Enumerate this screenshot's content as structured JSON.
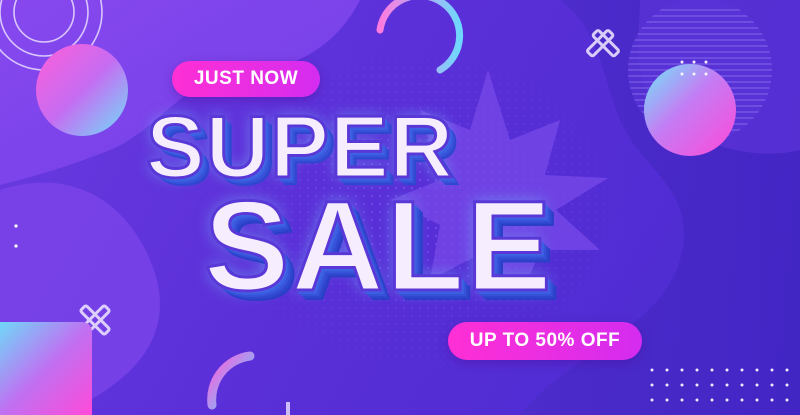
{
  "banner": {
    "badge_top": "JUST NOW",
    "headline_line1": "SUPER",
    "headline_line2": "SALE",
    "badge_bottom": "UP TO 50% OFF"
  },
  "colors": {
    "background": "#5a2fd8",
    "accent_pink": "#ff2fd4",
    "accent_magenta": "#d42cf0",
    "headline_fill": "#f6eefe",
    "headline_extrusion": "#3b5fe0"
  },
  "icons": [
    "concentric-circles-icon",
    "gradient-sphere-icon",
    "cross-icon",
    "arc-ring-icon",
    "starburst-icon",
    "dot-grid-icon",
    "stripe-circle-icon"
  ]
}
